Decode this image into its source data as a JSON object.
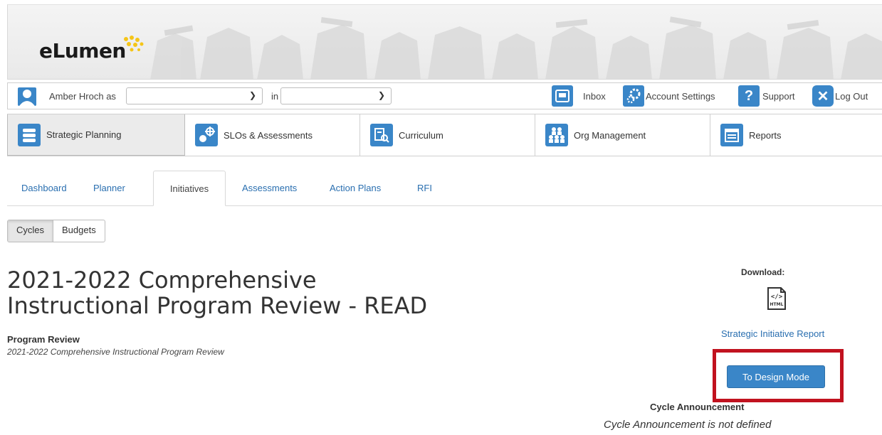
{
  "app": {
    "logo": "eLumen"
  },
  "userbar": {
    "user_name": "Amber Hroch as",
    "role_select_value": "",
    "in_label": "in",
    "scope_select_value": "",
    "inbox_label": "Inbox",
    "account_settings_label": "Account Settings",
    "support_label": "Support",
    "logout_label": "Log Out"
  },
  "modules": [
    {
      "label": "Strategic Planning",
      "icon": "strategic-planning-icon",
      "active": true
    },
    {
      "label": "SLOs & Assessments",
      "icon": "slo-icon"
    },
    {
      "label": "Curriculum",
      "icon": "curriculum-icon"
    },
    {
      "label": "Org Management",
      "icon": "org-management-icon"
    },
    {
      "label": "Reports",
      "icon": "reports-icon"
    }
  ],
  "subtabs": [
    {
      "label": "Dashboard"
    },
    {
      "label": "Planner"
    },
    {
      "label": "Initiatives",
      "active": true
    },
    {
      "label": "Assessments"
    },
    {
      "label": "Action Plans"
    },
    {
      "label": "RFI"
    }
  ],
  "segments": {
    "cycles": "Cycles",
    "budgets": "Budgets"
  },
  "page": {
    "title_line1": "2021-2022 Comprehensive",
    "title_line2": "Instructional Program Review - READ",
    "program_label": "Program Review",
    "program_sub": "2021-2022 Comprehensive Instructional Program Review"
  },
  "download": {
    "label": "Download:",
    "icon": "html-file-icon",
    "report_link": "Strategic Initiative Report"
  },
  "design_button": "To Design Mode",
  "announcement": {
    "label": "Cycle Announcement",
    "text": "Cycle Announcement is not defined"
  },
  "colors": {
    "accent": "#3a86c8",
    "link": "#2a6fb0",
    "highlight": "#c1121f"
  }
}
